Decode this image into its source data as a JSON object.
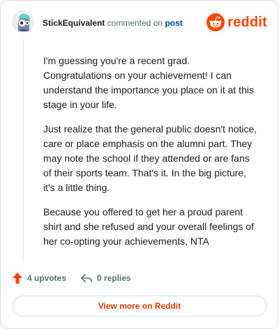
{
  "header": {
    "username": "StickEquivalent",
    "commented_text": "commented on",
    "post_link": "post",
    "brand_name": "reddit"
  },
  "comment": {
    "paragraphs": [
      "I'm guessing you're a recent grad. Congratulations on your achievement! I can understand the importance you place on it at this stage in your life.",
      "Just realize that the general public doesn't notice, care or place emphasis on the alumni part. They may note the school if they attended or are fans of their sports team. That's it. In the big picture, it's a little thing.",
      "Because you offered to get her a proud parent shirt and she refused and your overall feelings of her co-opting your achievements, NTA"
    ]
  },
  "actions": {
    "upvotes_label": "4 upvotes",
    "replies_label": "0 replies"
  },
  "footer": {
    "view_more_label": "View more on Reddit"
  },
  "colors": {
    "brand": "#ff4500",
    "link": "#0045ac",
    "view_more": "#d93a00",
    "upvote_icon": "#ff4500"
  },
  "icons": {
    "avatar": "snoo-avatar",
    "brand": "reddit-logo-icon",
    "upvote": "upvote-arrow-icon",
    "reply": "reply-arrow-icon"
  }
}
